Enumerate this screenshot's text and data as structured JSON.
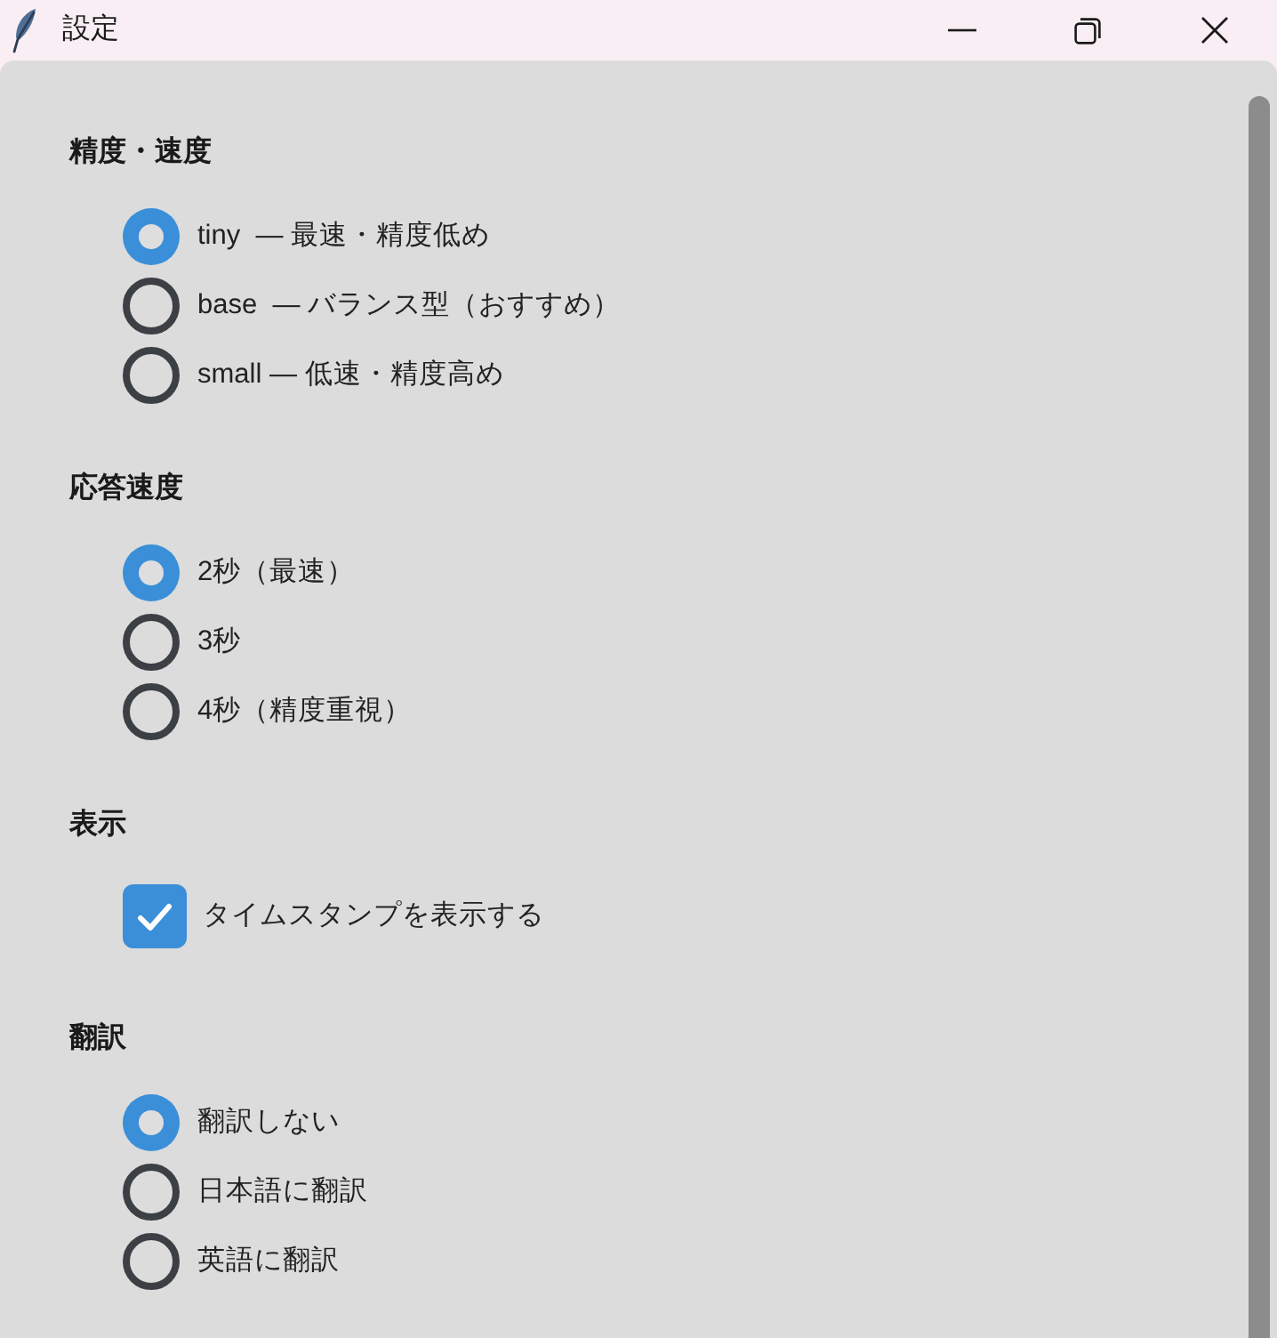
{
  "window": {
    "title": "設定"
  },
  "sections": [
    {
      "heading": "精度・速度",
      "options": [
        {
          "kind": "radio",
          "label": "tiny  — 最速・精度低め",
          "selected": true
        },
        {
          "kind": "radio",
          "label": "base  — バランス型（おすすめ）",
          "selected": false
        },
        {
          "kind": "radio",
          "label": "small — 低速・精度高め",
          "selected": false
        }
      ]
    },
    {
      "heading": "応答速度",
      "options": [
        {
          "kind": "radio",
          "label": "2秒（最速）",
          "selected": true
        },
        {
          "kind": "radio",
          "label": "3秒",
          "selected": false
        },
        {
          "kind": "radio",
          "label": "4秒（精度重視）",
          "selected": false
        }
      ]
    },
    {
      "heading": "表示",
      "options": [
        {
          "kind": "checkbox",
          "label": "タイムスタンプを表示する",
          "checked": true
        }
      ]
    },
    {
      "heading": "翻訳",
      "options": [
        {
          "kind": "radio",
          "label": "翻訳しない",
          "selected": true
        },
        {
          "kind": "radio",
          "label": "日本語に翻訳",
          "selected": false
        },
        {
          "kind": "radio",
          "label": "英語に翻訳",
          "selected": false
        }
      ]
    }
  ]
}
